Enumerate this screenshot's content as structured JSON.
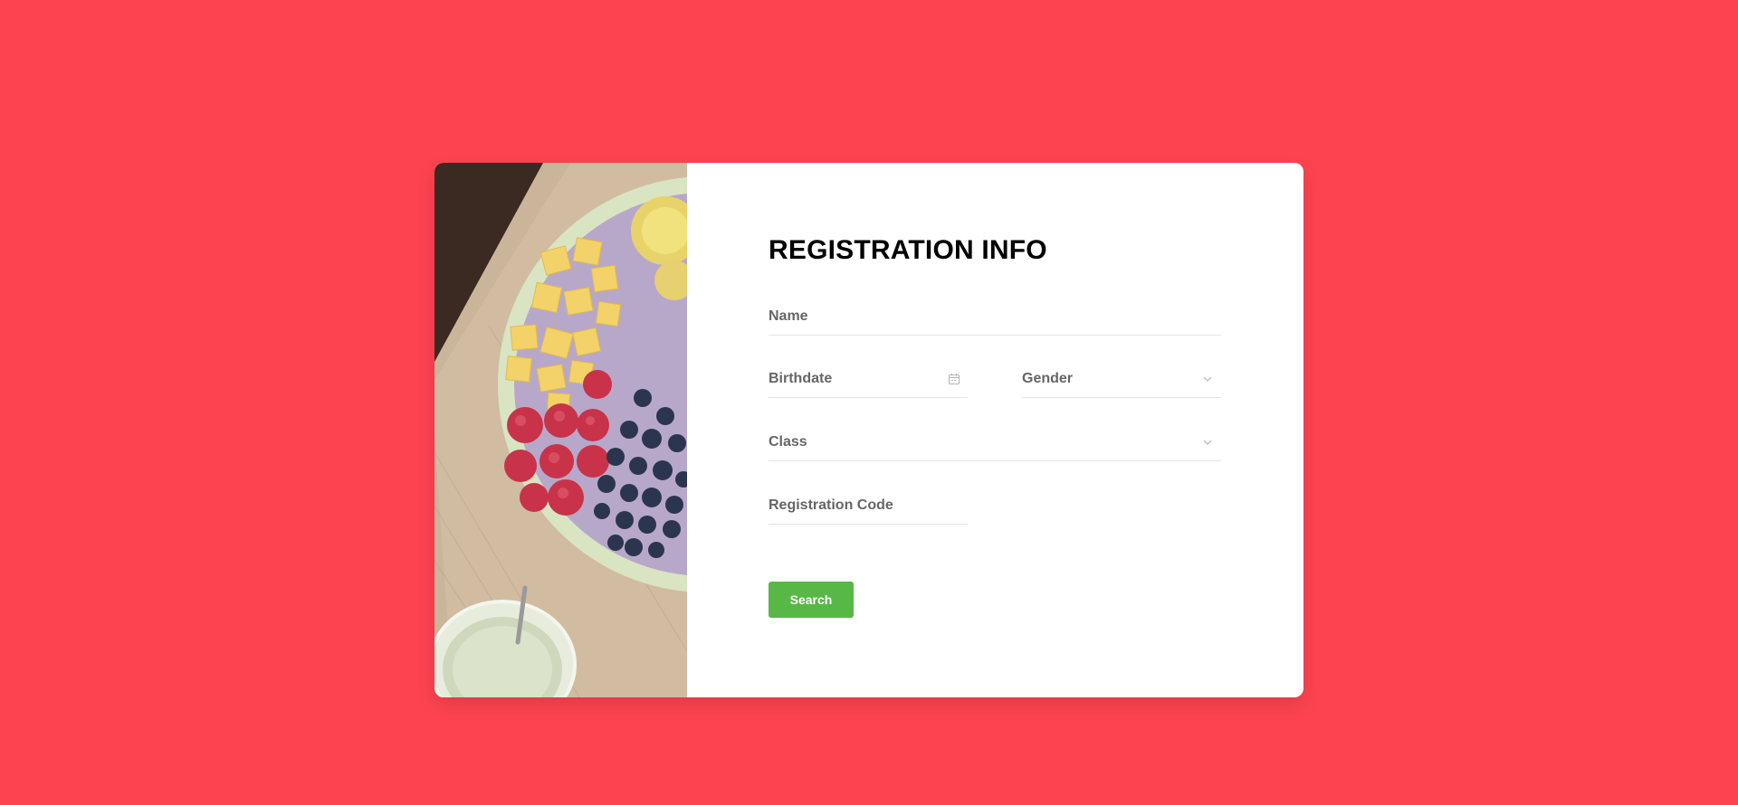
{
  "form": {
    "title": "REGISTRATION INFO",
    "fields": {
      "name": {
        "placeholder": "Name"
      },
      "birthdate": {
        "placeholder": "Birthdate",
        "icon": "calendar-icon"
      },
      "gender": {
        "placeholder": "Gender",
        "icon": "chevron-down-icon"
      },
      "class": {
        "placeholder": "Class",
        "icon": "chevron-down-icon"
      },
      "registration_code": {
        "placeholder": "Registration Code"
      }
    },
    "submit_label": "Search"
  },
  "colors": {
    "background": "#fe4350",
    "card": "#ffffff",
    "button": "#57b846",
    "input_border": "#e4e4e4",
    "label": "#666666"
  }
}
